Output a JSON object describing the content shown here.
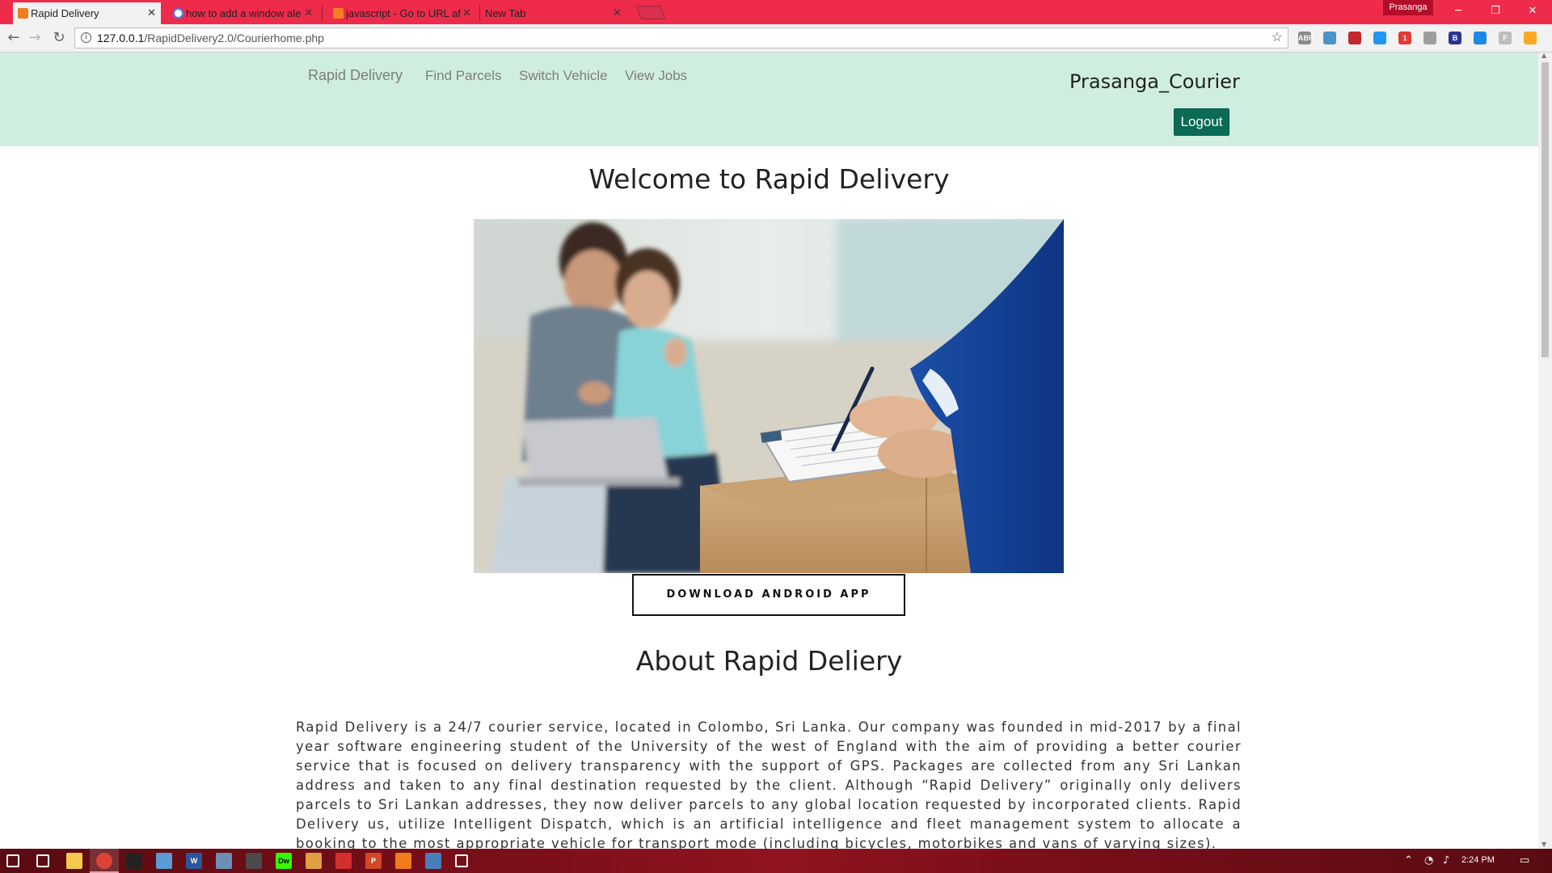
{
  "browser": {
    "tabs": [
      {
        "title": "Rapid Delivery",
        "active": true,
        "favicon_color": "#f07c1b"
      },
      {
        "title": "how to add a window ale",
        "active": false,
        "favicon_color": "#ffffff"
      },
      {
        "title": "javascript - Go to URL af",
        "active": false,
        "favicon_color": "#f48024"
      },
      {
        "title": "New Tab",
        "active": false,
        "favicon_color": ""
      }
    ],
    "profile_name": "Prasanga",
    "window_controls": {
      "minimize": "─",
      "restore": "❐",
      "close": "✕"
    },
    "url_host": "127.0.0.1",
    "url_path": "/RapidDelivery2.0/Courierhome.php",
    "extensions": [
      {
        "name": "abp-icon",
        "label": "ABP",
        "color": "#8a8a8a"
      },
      {
        "name": "extension-2-icon",
        "label": "",
        "color": "#4b93c9"
      },
      {
        "name": "extension-3-icon",
        "label": "",
        "color": "#c1272d"
      },
      {
        "name": "extension-4-icon",
        "label": "",
        "color": "#2196f3"
      },
      {
        "name": "extension-5-icon",
        "label": "1",
        "color": "#e53935"
      },
      {
        "name": "extension-6-icon",
        "label": "",
        "color": "#9e9e9e"
      },
      {
        "name": "extension-7-icon",
        "label": "B",
        "color": "#283593"
      },
      {
        "name": "extension-8-icon",
        "label": "",
        "color": "#1e88e5"
      },
      {
        "name": "extension-9-icon",
        "label": "F",
        "color": "#bdbdbd"
      },
      {
        "name": "extension-10-icon",
        "label": "",
        "color": "#f9a825"
      }
    ]
  },
  "site": {
    "nav": {
      "brand": "Rapid Delivery",
      "links": [
        "Find Parcels",
        "Switch Vehicle",
        "View Jobs"
      ]
    },
    "username": "Prasanga_Courier",
    "logout_label": "Logout",
    "welcome_heading": "Welcome to Rapid Delivery",
    "download_label": "DOWNLOAD ANDROID APP",
    "about_heading": "About Rapid Deliery",
    "about_text": "Rapid Delivery is a 24/7 courier service, located in Colombo, Sri Lanka. Our company was founded in mid-2017 by a final year software engineering student of the University of the west of England with the aim of providing a better courier service that is focused on delivery transparency with the support of GPS. Packages are collected from any Sri Lankan address and taken to any final destination requested by the client. Although “Rapid Delivery” originally only delivers parcels to Sri Lankan addresses, they now deliver parcels to any global location requested by incorporated clients. Rapid Delivery us, utilize Intelligent Dispatch, which is an artificial intelligence and fleet management system to allocate a booking to the most appropriate vehicle for transport mode (including bicycles, motorbikes and vans of varying sizes).",
    "colors": {
      "navbar_bg": "#d0eedf",
      "logout_bg": "#0b6b55",
      "chrome_accent": "#ee2b4a"
    }
  },
  "taskbar": {
    "clock": "2:24 PM",
    "apps": [
      {
        "name": "start-button",
        "label": "",
        "color": "#ffffff"
      },
      {
        "name": "task-view-icon",
        "label": "",
        "color": "#ffffff"
      },
      {
        "name": "file-explorer-icon",
        "label": "",
        "color": "#f2c94c"
      },
      {
        "name": "chrome-taskbar-icon",
        "label": "",
        "color": "#db4437"
      },
      {
        "name": "cmd-icon",
        "label": "",
        "color": "#222222"
      },
      {
        "name": "notepad-icon",
        "label": "",
        "color": "#5b9bd5"
      },
      {
        "name": "word-icon",
        "label": "W",
        "color": "#2b579a"
      },
      {
        "name": "app-icon-7",
        "label": "",
        "color": "#6d8fb5"
      },
      {
        "name": "app-icon-8",
        "label": "",
        "color": "#4a4a4a"
      },
      {
        "name": "dreamweaver-icon",
        "label": "Dw",
        "color": "#35fa00"
      },
      {
        "name": "app-icon-10",
        "label": "",
        "color": "#e0a040"
      },
      {
        "name": "acrobat-icon",
        "label": "",
        "color": "#d32f2f"
      },
      {
        "name": "powerpoint-icon",
        "label": "P",
        "color": "#d24726"
      },
      {
        "name": "xampp-icon",
        "label": "",
        "color": "#f07c1b"
      },
      {
        "name": "app-icon-14",
        "label": "",
        "color": "#4a7ebb"
      },
      {
        "name": "photos-icon",
        "label": "",
        "color": "#ffffff"
      }
    ]
  }
}
